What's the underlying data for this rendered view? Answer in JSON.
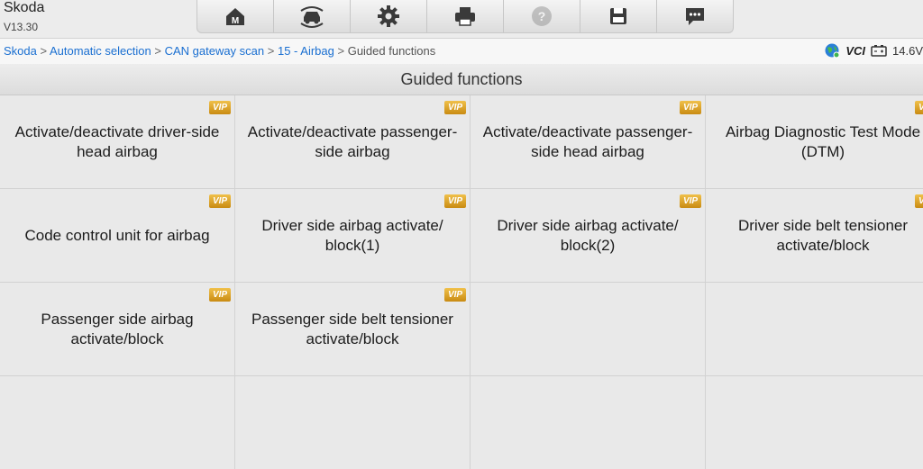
{
  "app": {
    "name": "Skoda",
    "version": "V13.30"
  },
  "toolbar": {
    "buttons": [
      {
        "name": "home-icon",
        "enabled": true
      },
      {
        "name": "vehicle-swap-icon",
        "enabled": true
      },
      {
        "name": "gear-icon",
        "enabled": true
      },
      {
        "name": "printer-icon",
        "enabled": true
      },
      {
        "name": "help-icon",
        "enabled": false
      },
      {
        "name": "save-icon",
        "enabled": true
      },
      {
        "name": "message-icon",
        "enabled": true
      }
    ]
  },
  "breadcrumb": {
    "items": [
      "Skoda",
      "Automatic selection",
      "CAN gateway scan",
      "15 - Airbag"
    ],
    "separator": ">",
    "current": "Guided functions"
  },
  "status": {
    "vci_label": "VCI",
    "voltage": "14.6V"
  },
  "page": {
    "title": "Guided functions"
  },
  "functions": [
    {
      "label": "Activate/deactivate driver-side head airbag",
      "badge": "VIP"
    },
    {
      "label": "Activate/deactivate passenger-side airbag",
      "badge": "VIP"
    },
    {
      "label": "Activate/deactivate passenger-side head airbag",
      "badge": "VIP"
    },
    {
      "label": "Airbag Diagnostic Test Mode (DTM)",
      "badge": "VIP"
    },
    {
      "label": "Code control unit for airbag",
      "badge": "VIP"
    },
    {
      "label": "Driver side airbag activate/ block(1)",
      "badge": "VIP"
    },
    {
      "label": "Driver side airbag activate/ block(2)",
      "badge": "VIP"
    },
    {
      "label": "Driver side belt tensioner activate/block",
      "badge": "VIP"
    },
    {
      "label": "Passenger side airbag activate/block",
      "badge": "VIP"
    },
    {
      "label": "Passenger side belt tensioner activate/block",
      "badge": "VIP"
    }
  ],
  "colors": {
    "link": "#1a6fd1",
    "vip_badge": "#d9a22a"
  }
}
